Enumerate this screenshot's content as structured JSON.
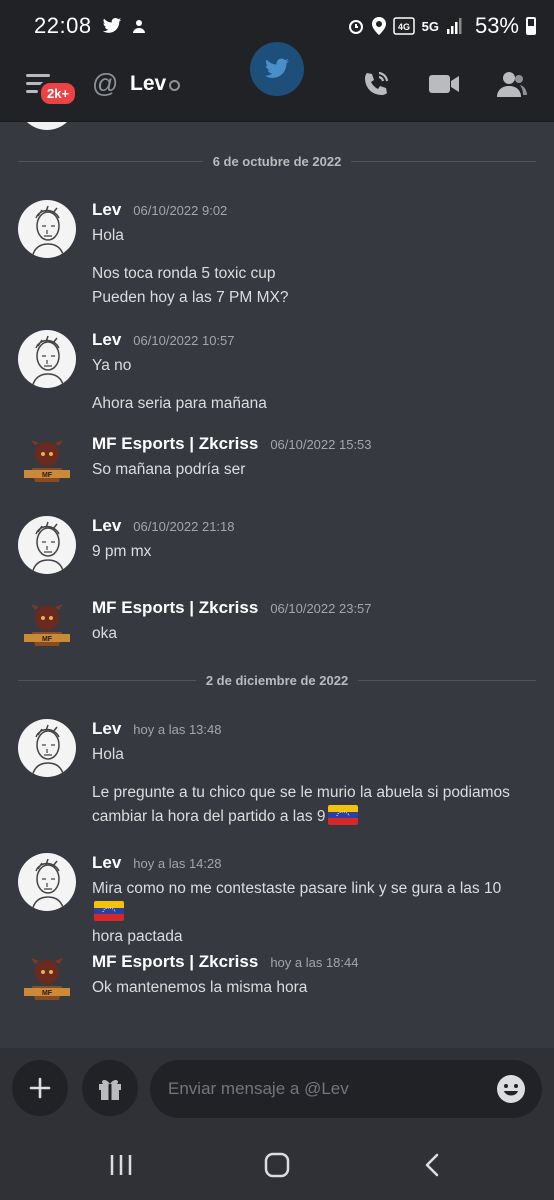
{
  "status_bar": {
    "time": "22:08",
    "battery": "53%",
    "network": "5G"
  },
  "header": {
    "notifications_badge": "2k+",
    "dm_name": "Lev"
  },
  "chat": {
    "dividers": [
      "6 de octubre de 2022",
      "2 de diciembre de 2022"
    ],
    "messages": [
      {
        "author": "Lev",
        "time": "06/10/2022 9:02",
        "lines": [
          "Hola",
          "Nos toca ronda 5 toxic cup",
          "Pueden hoy a las 7 PM MX?"
        ]
      },
      {
        "author": "Lev",
        "time": "06/10/2022 10:57",
        "lines": [
          "Ya no",
          "Ahora seria para mañana"
        ]
      },
      {
        "author": "MF Esports | Zkcriss",
        "time": "06/10/2022 15:53",
        "lines": [
          "So mañana podría ser"
        ]
      },
      {
        "author": "Lev",
        "time": "06/10/2022 21:18",
        "lines": [
          "9 pm mx"
        ]
      },
      {
        "author": "MF Esports | Zkcriss",
        "time": "06/10/2022 23:57",
        "lines": [
          "oka"
        ]
      },
      {
        "author": "Lev",
        "time": "hoy a las 13:48",
        "lines": [
          "Hola",
          "Le pregunte a tu chico que se le murio la abuela si podiamos",
          "cambiar la hora del partido a las 9"
        ]
      },
      {
        "author": "Lev",
        "time": "hoy a las 14:28",
        "lines": [
          "Mira como no me contestaste pasare link y se gura a las 10",
          "hora pactada"
        ]
      },
      {
        "author": "MF Esports | Zkcriss",
        "time": "hoy a las 18:44",
        "lines": [
          "Ok mantenemos la misma hora"
        ]
      }
    ]
  },
  "composer": {
    "placeholder": "Enviar mensaje a @Lev"
  },
  "colors": {
    "background": "#36393f",
    "bars": "#202225",
    "badge": "#ed4245",
    "text": "#dcddde",
    "muted": "#a3a6aa"
  }
}
